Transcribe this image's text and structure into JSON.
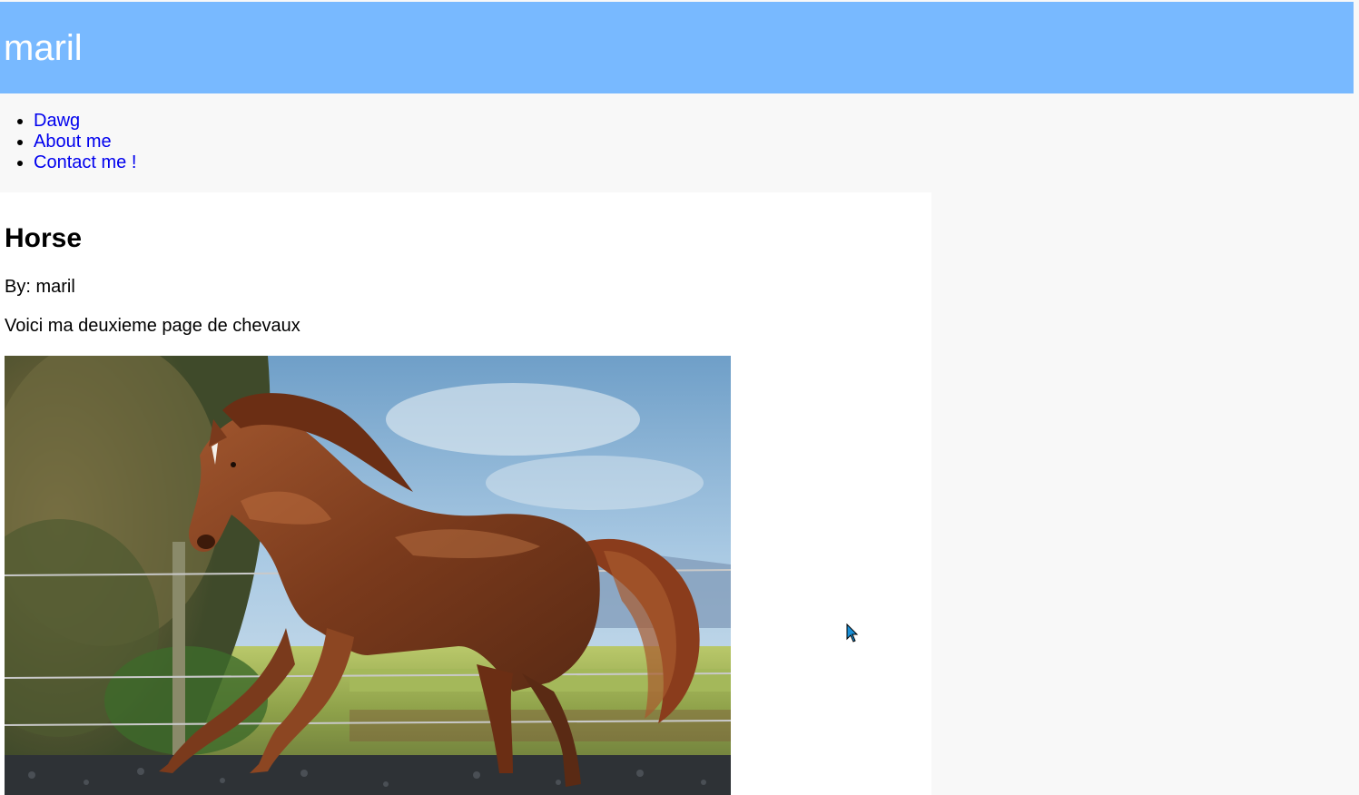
{
  "header": {
    "title": "maril"
  },
  "nav": {
    "items": [
      {
        "label": "Dawg"
      },
      {
        "label": "About me"
      },
      {
        "label": "Contact me !"
      }
    ]
  },
  "post": {
    "title": "Horse",
    "byline": "By: maril",
    "description": "Voici ma deuxieme page de chevaux",
    "image": {
      "alt": "photo of a chestnut horse galloping in a paddock"
    }
  },
  "colors": {
    "header_bg": "#78b9ff",
    "page_bg": "#f8f8f8",
    "link": "#0000ee"
  }
}
